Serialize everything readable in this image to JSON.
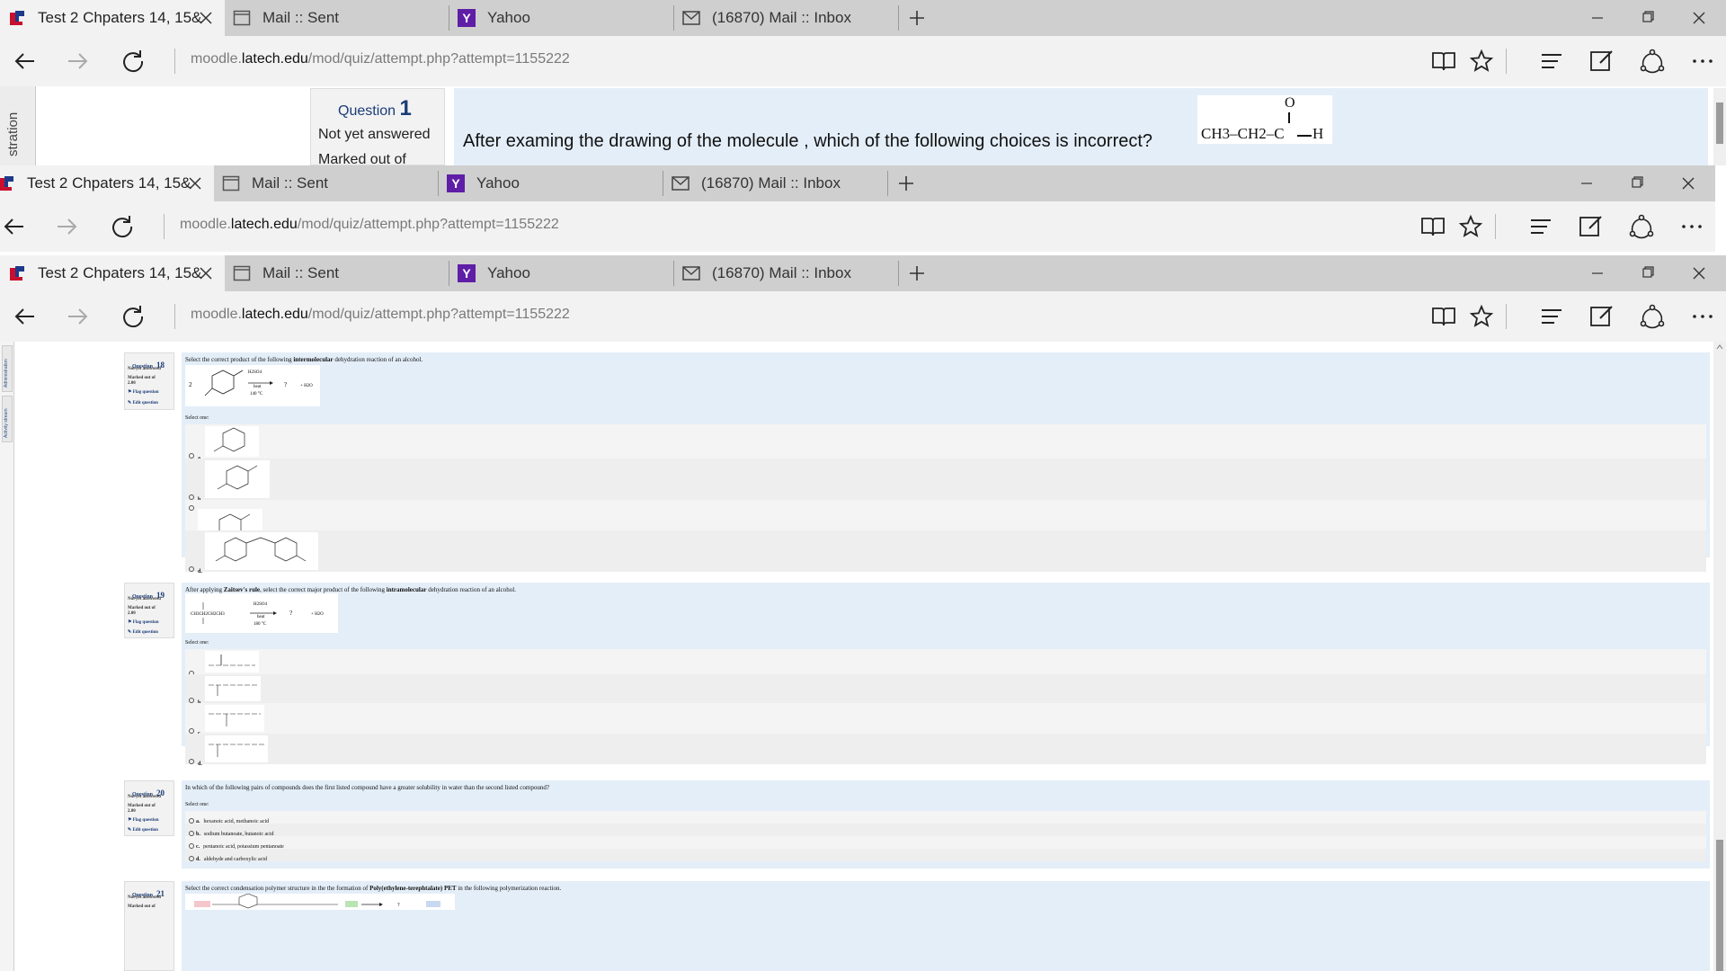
{
  "browser": {
    "tabs": [
      {
        "label": "Test 2 Chpaters 14, 15&",
        "icon": "latech-icon",
        "active": true
      },
      {
        "label": "Mail :: Sent",
        "icon": "page-icon",
        "active": false
      },
      {
        "label": "Yahoo",
        "icon": "yahoo-icon",
        "active": false
      },
      {
        "label": "(16870) Mail :: Inbox",
        "icon": "mail-icon",
        "active": false
      }
    ],
    "url_prefix": "moodle.",
    "url_domain": "latech.edu",
    "url_path": "/mod/quiz/attempt.php?attempt=1155222"
  },
  "top_window": {
    "sidebar_label": "stration",
    "question_label": "Question",
    "question_number": "1",
    "status": "Not yet answered",
    "marked": "Marked out of",
    "question_text": "After examing the drawing of the molecule , which of the following choices is incorrect?",
    "molecule": {
      "left": "CH3–CH2–C",
      "top": "O",
      "right": "H"
    }
  },
  "page": {
    "sidebar_labels": [
      "Administration",
      "Activity stream"
    ],
    "questions": [
      {
        "label": "Question",
        "number": "18",
        "status": "Not yet answered",
        "marked": "Marked out of",
        "marks": "2.00",
        "flag": "Flag question",
        "edit": "Edit question",
        "text_before": "Select the correct product of the following ",
        "text_bold": "intermolecular",
        "text_after": " dehydration reaction of an alcohol.",
        "reagents": [
          "H2SO4",
          "heat",
          "140 °C"
        ],
        "select_one": "Select one:",
        "options": [
          "a.",
          "b.",
          "c.",
          "d."
        ]
      },
      {
        "label": "Question",
        "number": "19",
        "status": "Not yet answered",
        "marked": "Marked out of",
        "marks": "2.00",
        "flag": "Flag question",
        "edit": "Edit question",
        "text_before": "After applying ",
        "text_bold": "Zaitsev's rule",
        "text_after": ", select the correct major product of the following ",
        "text_bold2": "intramolecular",
        "text_after2": " dehydration reaction of an alcohol.",
        "reagents": [
          "H2SO4",
          "heat",
          "180 °C"
        ],
        "select_one": "Select one:",
        "options": [
          "a.",
          "b.",
          "c.",
          "d."
        ]
      },
      {
        "label": "Question",
        "number": "20",
        "status": "Not yet answered",
        "marked": "Marked out of",
        "marks": "2.00",
        "flag": "Flag question",
        "edit": "Edit question",
        "text": "In which of the following pairs of compounds does the first listed compound have a greater solubility in water than the second listed compound?",
        "select_one": "Select one:",
        "options": [
          {
            "letter": "a.",
            "text": "hexanoic acid, methanoic acid"
          },
          {
            "letter": "b.",
            "text": "sodium butanoate, butanoic acid"
          },
          {
            "letter": "c.",
            "text": "pentanoic acid, potassium pentanoate"
          },
          {
            "letter": "d.",
            "text": "aldehyde and carboxylic acid"
          }
        ]
      },
      {
        "label": "Question",
        "number": "21",
        "status": "Not yet answered",
        "marked": "Marked out of",
        "text_before": "Select the correct condensation polymer structure in the the formation of ",
        "text_bold": "Poly(ethylene-terephtalate) PET",
        "text_after": " in the following polymerization reaction."
      }
    ]
  },
  "colors": {
    "tabbar": "#cfcfcf",
    "active_tab": "#f2f2f2",
    "question_panel": "#e4eef8",
    "question_number": "#1a3c78"
  }
}
